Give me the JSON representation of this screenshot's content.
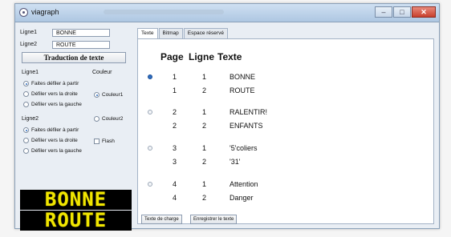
{
  "window": {
    "title": "viagraph"
  },
  "controls": {
    "minimize_glyph": "–",
    "maximize_glyph": "□",
    "close_glyph": "✕"
  },
  "left": {
    "line1": {
      "label": "Ligne1",
      "value": "BONNE"
    },
    "line2": {
      "label": "Ligne2",
      "value": "ROUTE"
    },
    "translate_button": "Traduction de texte",
    "group1": {
      "label": "Ligne1",
      "options": [
        "Faites défiler à partir",
        "Défiler vers la droite",
        "Défiler vers la gauche"
      ],
      "selected": 0
    },
    "group2": {
      "label": "Ligne2",
      "options": [
        "Faites défiler à partir",
        "Défiler vers la droite",
        "Défiler vers la gauche"
      ],
      "selected": 0
    },
    "color_group": {
      "label": "Couleur",
      "options": [
        "Couleur1",
        "Couleur2"
      ],
      "selected": 0
    },
    "flash_label": "Flash",
    "led_display": {
      "line1": "BONNE",
      "line2": "ROUTE",
      "color": "#f1e600"
    }
  },
  "tabs": [
    "Texte",
    "Bitmap",
    "Espace réservé"
  ],
  "table": {
    "headers": {
      "page": "Page",
      "ligne": "Ligne",
      "texte": "Texte"
    },
    "selected_group": 0,
    "groups": [
      {
        "rows": [
          {
            "page": "1",
            "ligne": "1",
            "texte": "BONNE"
          },
          {
            "page": "1",
            "ligne": "2",
            "texte": "ROUTE"
          }
        ]
      },
      {
        "rows": [
          {
            "page": "2",
            "ligne": "1",
            "texte": "RALENTIR!"
          },
          {
            "page": "2",
            "ligne": "2",
            "texte": "ENFANTS"
          }
        ]
      },
      {
        "rows": [
          {
            "page": "3",
            "ligne": "1",
            "texte": "'5'coliers"
          },
          {
            "page": "3",
            "ligne": "2",
            "texte": "'31'"
          }
        ]
      },
      {
        "rows": [
          {
            "page": "4",
            "ligne": "1",
            "texte": "Attention"
          },
          {
            "page": "4",
            "ligne": "2",
            "texte": "Danger"
          }
        ]
      }
    ]
  },
  "buttons": {
    "load": "Texte de charge",
    "save": "Enregistrer le texte"
  }
}
